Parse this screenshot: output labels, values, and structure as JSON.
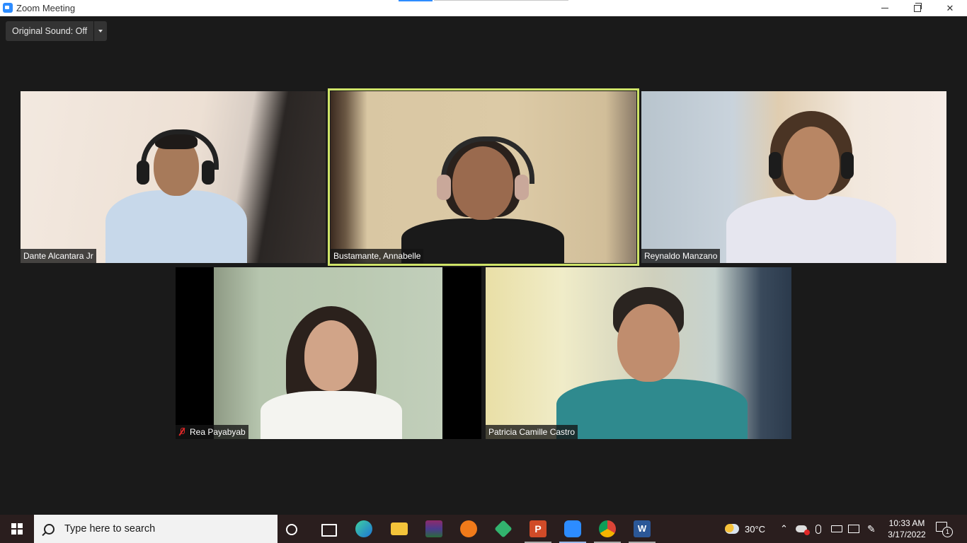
{
  "window": {
    "title": "Zoom Meeting"
  },
  "toolbar": {
    "original_sound_label": "Original Sound: Off"
  },
  "participants": [
    {
      "name": "Dante Alcantara Jr",
      "muted": false,
      "active_speaker": false
    },
    {
      "name": "Bustamante, Annabelle",
      "muted": false,
      "active_speaker": true
    },
    {
      "name": "Reynaldo Manzano",
      "muted": false,
      "active_speaker": false
    },
    {
      "name": "Rea Payabyab",
      "muted": true,
      "active_speaker": false
    },
    {
      "name": "Patricia Camille Castro",
      "muted": false,
      "active_speaker": false
    }
  ],
  "taskbar": {
    "search_placeholder": "Type here to search",
    "apps": [
      "cortana-icon",
      "task-view-icon",
      "edge-icon",
      "file-explorer-icon",
      "winrar-icon",
      "brave-icon",
      "vpn-icon",
      "powerpoint-icon",
      "zoom-icon",
      "chrome-icon",
      "word-icon"
    ],
    "weather": "30°C",
    "time": "10:33 AM",
    "date": "3/17/2022",
    "notification_count": "1"
  },
  "colors": {
    "active_speaker_border": "#cfe468",
    "taskbar_bg": "#2a1e1e",
    "meeting_bg": "#1a1a1a"
  }
}
